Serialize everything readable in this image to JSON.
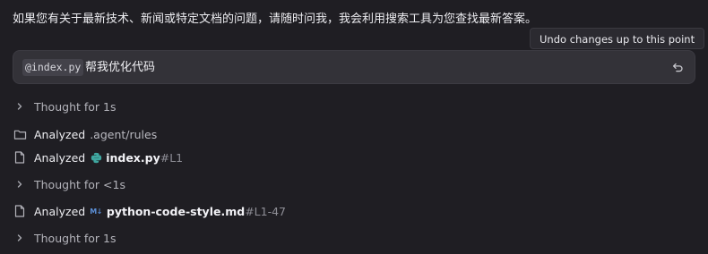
{
  "message": {
    "intro": "如果您有关于最新技术、新闻或特定文档的问题，请随时问我，我会利用搜索工具为您查找最新答案。"
  },
  "tooltip": {
    "text": "Undo changes up to this point"
  },
  "prompt": {
    "mention": "@index.py",
    "text": "帮我优化代码",
    "undo_icon": "undo-icon"
  },
  "steps": [
    {
      "kind": "thought",
      "label": "Thought for 1s",
      "icon": "chevron-right-icon"
    },
    {
      "kind": "analyzed",
      "label": "Analyzed",
      "path": ".agent/rules",
      "icon": "folder-icon"
    },
    {
      "kind": "analyzed",
      "label": "Analyzed",
      "file": "index.py",
      "range": "#L1",
      "icon": "file-icon",
      "file_icon": "python-icon"
    },
    {
      "kind": "thought",
      "label": "Thought for <1s",
      "icon": "chevron-right-icon"
    },
    {
      "kind": "analyzed",
      "label": "Analyzed",
      "file": "python-code-style.md",
      "range": "#L1-47",
      "icon": "file-icon",
      "file_icon": "markdown-icon",
      "file_icon_text": "M↓"
    },
    {
      "kind": "thought",
      "label": "Thought for 1s",
      "icon": "chevron-right-icon"
    }
  ]
}
